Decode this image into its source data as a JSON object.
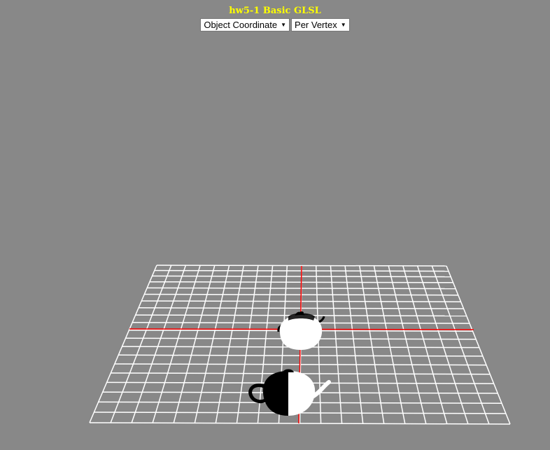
{
  "page": {
    "title": "hw5-1 Basic GLSL",
    "background": "#888888",
    "title_color": "#ffff00"
  },
  "controls": {
    "coordinate_select": {
      "selected": "Object Coordinate"
    },
    "shading_select": {
      "selected": "Per Vertex"
    }
  },
  "scene": {
    "grid_color": "#ffffff",
    "axis_color": "#ff0000",
    "objects": [
      "teapot",
      "teapot"
    ]
  }
}
